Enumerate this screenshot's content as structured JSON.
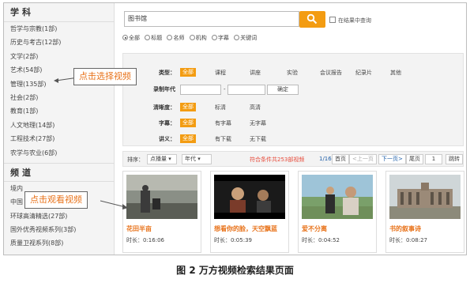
{
  "sidebar": {
    "subject_header": "学科",
    "subjects": [
      "哲学与宗教(1部)",
      "历史与考古(12部)",
      "文学(2部)",
      "艺术(54部)",
      "管理(135部)",
      "社会(2部)",
      "教育(1部)",
      "人文地理(14部)",
      "工程技术(27部)",
      "农学与农业(6部)"
    ],
    "channel_header": "频道",
    "channels": [
      "境内",
      "中国",
      "环球高清精选(27部)",
      "国外优秀视频系列(3部)",
      "质量卫视系列(8部)"
    ]
  },
  "search": {
    "value": "图书馆",
    "in_result_label": "在结果中查询"
  },
  "scope": [
    "全部",
    "标题",
    "名师",
    "机构",
    "字幕",
    "关键词"
  ],
  "filters": {
    "type_label": "类型：",
    "type_options": [
      "全部",
      "课程",
      "讲座",
      "实验",
      "会议报告",
      "纪录片",
      "其他"
    ],
    "year_label": "录制年代",
    "year_dash": "-",
    "confirm_label": "确定",
    "clarity_label": "清晰度：",
    "clarity_options": [
      "全部",
      "标清",
      "高清"
    ],
    "subtitle_label": "字幕：",
    "subtitle_options": [
      "全部",
      "有字幕",
      "无字幕"
    ],
    "handout_label": "讲义：",
    "handout_options": [
      "全部",
      "有下载",
      "无下载"
    ]
  },
  "sortbar": {
    "sort_label": "排序：",
    "by_plays": "点播量",
    "by_year": "年代",
    "result_count": "符合条件共253部视频",
    "page_info": "1/16",
    "first_label": "首页",
    "prev_label": "上一页",
    "next_label": "下一页",
    "last_label": "尾页",
    "page_input": "1",
    "jump_label": "跳转"
  },
  "videos": [
    {
      "title": "花田半亩",
      "duration": "时长：0:16:06"
    },
    {
      "title": "想看你的脸，天空飘蓝",
      "duration": "时长：0:05:39"
    },
    {
      "title": "爱不分离",
      "duration": "时长：0:04:52"
    },
    {
      "title": "书的叙事诗",
      "duration": "时长：0:08:27"
    }
  ],
  "callouts": {
    "select_video": "点击选择视频",
    "watch_video": "点击观看视频"
  },
  "caption": "图 2  万方视频检索结果页面",
  "colors": {
    "accent": "#f39c12",
    "highlight_text": "#e8731b",
    "count_text": "#e74c3c"
  }
}
